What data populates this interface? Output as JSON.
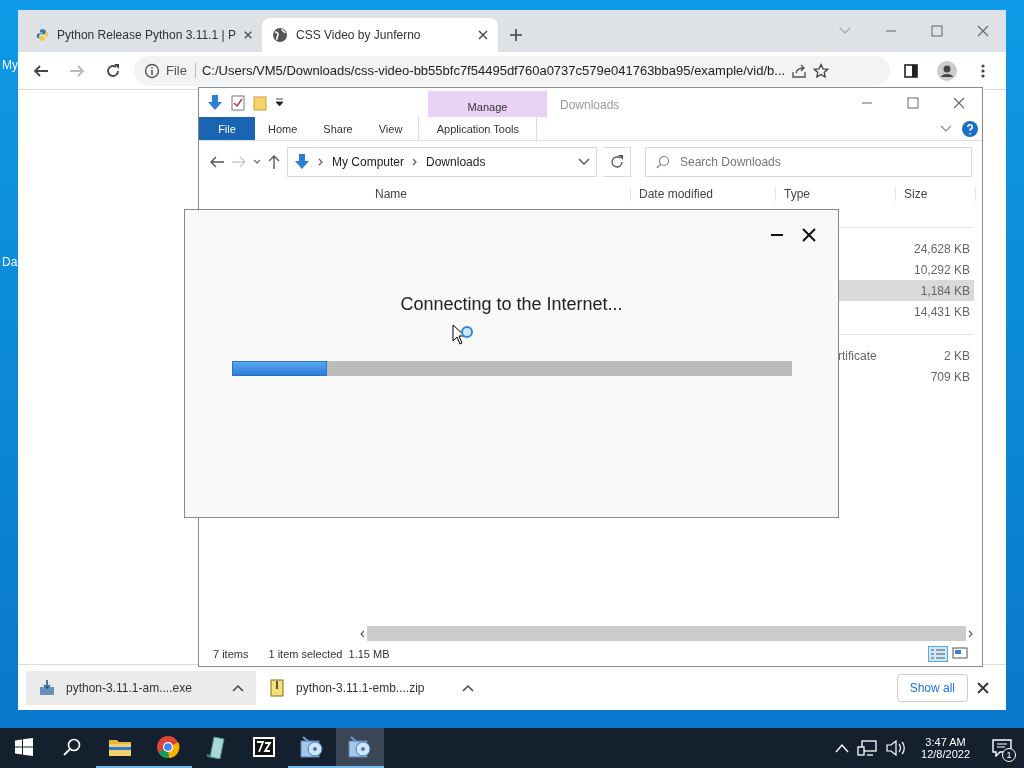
{
  "desktop": {
    "icon_labels": [
      "My",
      "Da"
    ]
  },
  "browser": {
    "tabs": [
      {
        "title": "Python Release Python 3.11.1 | P",
        "kind": "python",
        "selected": false
      },
      {
        "title": "CSS Video by Junferno",
        "kind": "globe",
        "selected": true
      }
    ],
    "address": {
      "scheme": "File",
      "url": "C:/Users/VM5/Downloads/css-video-bb55bfc7f54495df760a0737c579e041763bba95/example/vid/b..."
    },
    "downloads": [
      {
        "name": "python-3.11.1-am....exe",
        "kind": "installer",
        "selected": true
      },
      {
        "name": "python-3.11.1-emb....zip",
        "kind": "archive",
        "selected": false
      }
    ],
    "show_all": "Show all"
  },
  "explorer": {
    "context_label": "Manage",
    "title": "Downloads",
    "ribbon_tabs": [
      {
        "label": "File",
        "kind": "file"
      },
      {
        "label": "Home",
        "kind": "tab"
      },
      {
        "label": "Share",
        "kind": "tab"
      },
      {
        "label": "View",
        "kind": "tab"
      },
      {
        "label": "Application Tools",
        "kind": "context"
      }
    ],
    "breadcrumb": [
      "My Computer",
      "Downloads"
    ],
    "search": {
      "placeholder": "Search Downloads"
    },
    "columns": [
      "Name",
      "Date modified",
      "Type",
      "Size"
    ],
    "groups": [
      {
        "rows": [
          {
            "size": "24,628 KB",
            "selected": false
          },
          {
            "size": "10,292 KB",
            "selected": false
          },
          {
            "size": "1,184 KB",
            "selected": true
          },
          {
            "size": "14,431 KB",
            "selected": false
          }
        ]
      },
      {
        "rows": [
          {
            "type": "rtificate",
            "size": "2 KB",
            "selected": false
          },
          {
            "size": "709 KB",
            "selected": false
          }
        ]
      }
    ],
    "status": {
      "count": "7 items",
      "selection": "1 item selected  1.15 MB"
    }
  },
  "dialog": {
    "message": "Connecting to the Internet...",
    "progress": {
      "level": 0.17
    }
  },
  "taskbar": {
    "apps": [
      {
        "kind": "folder",
        "running": true,
        "selected": false
      },
      {
        "kind": "chrome",
        "running": true,
        "selected": false
      },
      {
        "kind": "app",
        "running": false,
        "selected": false
      },
      {
        "kind": "sevenzip",
        "running": false,
        "selected": false
      },
      {
        "kind": "setup",
        "running": true,
        "selected": false
      },
      {
        "kind": "setup",
        "running": true,
        "selected": true
      }
    ],
    "time": "3:47 AM",
    "date": "12/8/2022",
    "notifications": "1"
  }
}
